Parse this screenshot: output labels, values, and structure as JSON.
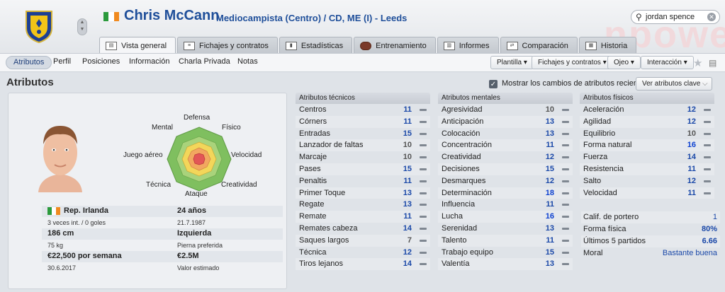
{
  "header": {
    "player_name": "Chris McCann",
    "player_sub": "Mediocampista (Centro) / CD, ME (I) - Leeds",
    "watermark": "npowe",
    "search_value": "jordan spence"
  },
  "tabs": [
    {
      "label": "Vista general",
      "icon": "overview-icon"
    },
    {
      "label": "Fichajes y contratos",
      "icon": "contract-icon"
    },
    {
      "label": "Estadísticas",
      "icon": "stats-icon"
    },
    {
      "label": "Entrenamiento",
      "icon": "ball-icon"
    },
    {
      "label": "Informes",
      "icon": "report-icon"
    },
    {
      "label": "Comparación",
      "icon": "compare-icon"
    },
    {
      "label": "Historia",
      "icon": "history-icon"
    }
  ],
  "subnav": {
    "items": [
      "Atributos",
      "Perfil",
      "Posiciones",
      "Información",
      "Charla Privada",
      "Notas"
    ],
    "dropdowns": [
      "Plantilla",
      "Fichajes y contratos",
      "Ojeo",
      "Interacción"
    ]
  },
  "section": {
    "title": "Atributos",
    "checkbox_label": "Mostrar los cambios de atributos recientes",
    "key_button": "Ver atributos clave"
  },
  "radar": {
    "labels": {
      "top": "Defensa",
      "top_left": "Mental",
      "top_right": "Físico",
      "left": "Juego aéreo",
      "right": "Velocidad",
      "bottom_left": "Técnica",
      "bottom_right": "Creatividad",
      "bottom": "Ataque"
    }
  },
  "info": {
    "nationality": "Rep. Irlanda",
    "caps": "3 veces int. / 0 goles",
    "age": "24 años",
    "dob": "21.7.1987",
    "height": "186 cm",
    "weight": "75 kg",
    "foot": "Izquierda",
    "foot_label": "Pierna preferida",
    "wage": "€22,500 por semana",
    "contract_end": "30.6.2017",
    "value": "€2.5M",
    "value_label": "Valor estimado"
  },
  "technical": {
    "title": "Atributos técnicos",
    "rows": [
      {
        "name": "Centros",
        "value": "11"
      },
      {
        "name": "Córners",
        "value": "11"
      },
      {
        "name": "Entradas",
        "value": "15"
      },
      {
        "name": "Lanzador de faltas",
        "value": "10"
      },
      {
        "name": "Marcaje",
        "value": "10"
      },
      {
        "name": "Pases",
        "value": "15"
      },
      {
        "name": "Penaltis",
        "value": "11"
      },
      {
        "name": "Primer Toque",
        "value": "13"
      },
      {
        "name": "Regate",
        "value": "13"
      },
      {
        "name": "Remate",
        "value": "11"
      },
      {
        "name": "Remates cabeza",
        "value": "14"
      },
      {
        "name": "Saques largos",
        "value": "7"
      },
      {
        "name": "Técnica",
        "value": "12"
      },
      {
        "name": "Tiros lejanos",
        "value": "14"
      }
    ]
  },
  "mental": {
    "title": "Atributos mentales",
    "rows": [
      {
        "name": "Agresividad",
        "value": "10"
      },
      {
        "name": "Anticipación",
        "value": "13"
      },
      {
        "name": "Colocación",
        "value": "13"
      },
      {
        "name": "Concentración",
        "value": "11"
      },
      {
        "name": "Creatividad",
        "value": "12"
      },
      {
        "name": "Decisiones",
        "value": "15"
      },
      {
        "name": "Desmarques",
        "value": "12"
      },
      {
        "name": "Determinación",
        "value": "18"
      },
      {
        "name": "Influencia",
        "value": "11"
      },
      {
        "name": "Lucha",
        "value": "16"
      },
      {
        "name": "Serenidad",
        "value": "13"
      },
      {
        "name": "Talento",
        "value": "11"
      },
      {
        "name": "Trabajo equipo",
        "value": "15"
      },
      {
        "name": "Valentía",
        "value": "13"
      }
    ]
  },
  "physical": {
    "title": "Atributos físicos",
    "rows": [
      {
        "name": "Aceleración",
        "value": "12"
      },
      {
        "name": "Agilidad",
        "value": "12"
      },
      {
        "name": "Equilibrio",
        "value": "10"
      },
      {
        "name": "Forma natural",
        "value": "16"
      },
      {
        "name": "Fuerza",
        "value": "14"
      },
      {
        "name": "Resistencia",
        "value": "11"
      },
      {
        "name": "Salto",
        "value": "12"
      },
      {
        "name": "Velocidad",
        "value": "11"
      }
    ],
    "extra": [
      {
        "name": "Calif. de portero",
        "value": "1"
      },
      {
        "name": "Forma física",
        "value": "80%"
      },
      {
        "name": "Últimos 5 partidos",
        "value": "6.66"
      },
      {
        "name": "Moral",
        "value": "Bastante buena"
      }
    ]
  },
  "colors": {
    "accent": "#1f4f9a",
    "value_blue": "#1a48a8",
    "value_grey": "#555555",
    "value_highlight": "#0b3fd0"
  }
}
